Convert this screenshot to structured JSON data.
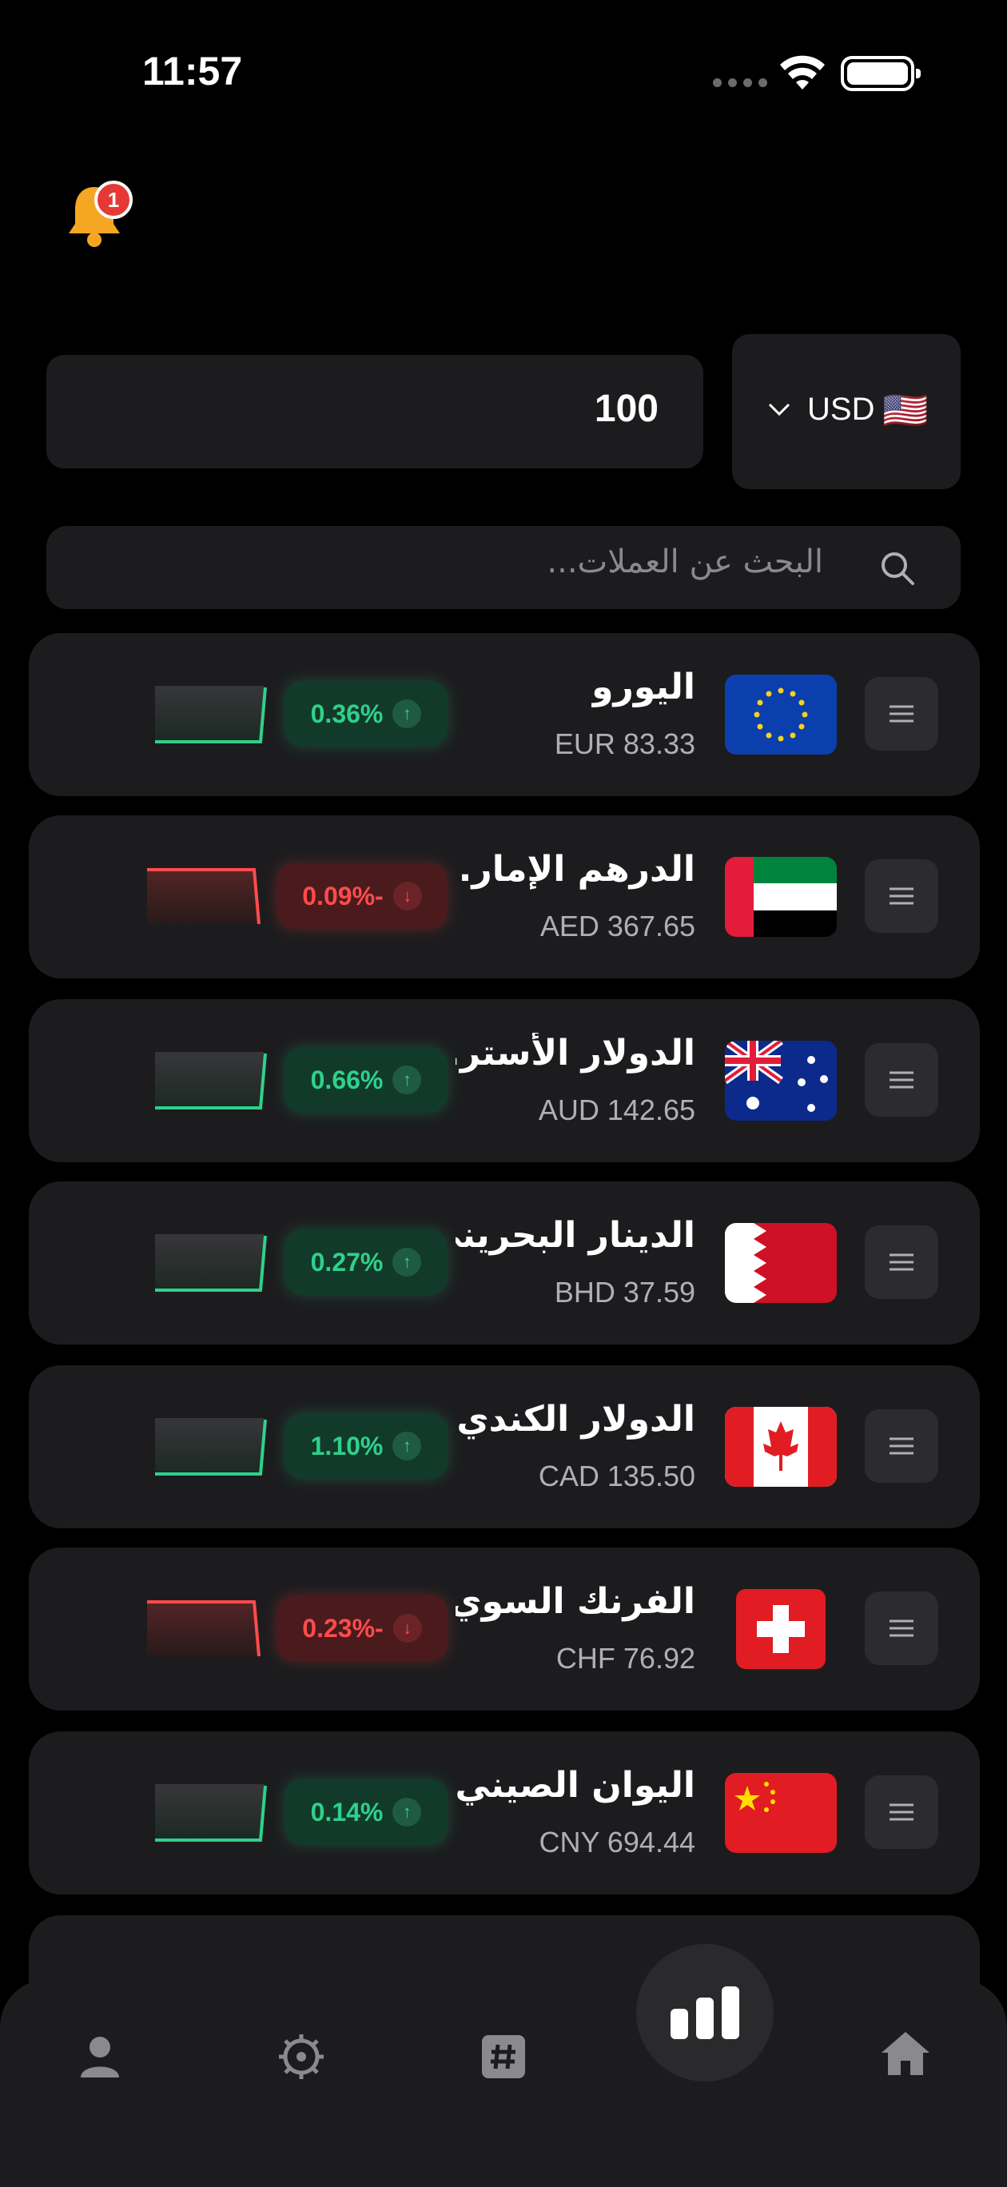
{
  "status_bar": {
    "time": "11:57"
  },
  "notifications": {
    "badge_count": "1"
  },
  "converter": {
    "amount": "100",
    "currency_code": "USD",
    "currency_flag": "🇺🇸"
  },
  "search": {
    "placeholder": "البحث عن العملات..."
  },
  "currencies": [
    {
      "name": "اليورو",
      "rate": "EUR 83.33",
      "change": "0.36%",
      "direction": "up",
      "flag": "eu"
    },
    {
      "name": "الدرهم الإمار...",
      "rate": "AED 367.65",
      "change": "0.09%-",
      "direction": "down",
      "flag": "ae"
    },
    {
      "name": "الدولار الأستر...",
      "rate": "AUD 142.65",
      "change": "0.66%",
      "direction": "up",
      "flag": "au"
    },
    {
      "name": "الدينار البحريني",
      "rate": "BHD 37.59",
      "change": "0.27%",
      "direction": "up",
      "flag": "bh"
    },
    {
      "name": "الدولار الكندي",
      "rate": "CAD 135.50",
      "change": "1.10%",
      "direction": "up",
      "flag": "ca"
    },
    {
      "name": "الفرنك السوي...",
      "rate": "CHF 76.92",
      "change": "0.23%-",
      "direction": "down",
      "flag": "ch"
    },
    {
      "name": "اليوان الصيني",
      "rate": "CNY 694.44",
      "change": "0.14%",
      "direction": "up",
      "flag": "cn"
    }
  ],
  "colors": {
    "up": "#2fd18a",
    "down": "#ff4b4b",
    "card": "#1c1c1e",
    "bell": "#f5a623"
  },
  "nav": {
    "items": [
      "profile-icon",
      "settings-icon",
      "hashtag-icon",
      "chart-icon",
      "home-icon"
    ],
    "active": "chart-icon"
  }
}
